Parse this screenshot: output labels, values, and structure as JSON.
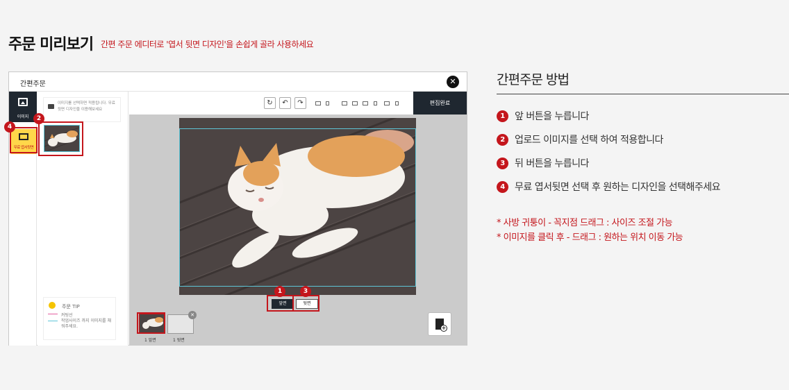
{
  "header": {
    "title": "주문 미리보기",
    "subtitle": "간편 주문 에디터로 '엽서 뒷면 디자인'을 손쉽게 골라 사용하세요"
  },
  "editor": {
    "window_title": "간편주문",
    "close_icon": "close-icon",
    "nav": {
      "image_label": "이미지",
      "postcard_label": "무료 엽서뒷면"
    },
    "panel": {
      "info_text": "이미지를 선택하면 적용됩니다. 무료 뒷면 디자인을 이용해보세요"
    },
    "tip": {
      "title": "주문 TIP",
      "line1": "커팅선",
      "line2": "작업사이즈 까지 이미지를 채워주세요."
    },
    "toolbar": {
      "done_label": "편집완료",
      "icons": [
        "rotate-icon",
        "rotate-left-90-icon",
        "rotate-right-90-icon",
        "size-option-icons"
      ]
    },
    "sides": {
      "front_label": "앞면",
      "back_label": "뒷면"
    },
    "pages": {
      "page1_label": "1 앞면",
      "page2_label": "1 뒷면"
    },
    "badges": {
      "b1": "1",
      "b2": "2",
      "b3": "3",
      "b4": "4"
    }
  },
  "howto": {
    "title": "간편주문 방법",
    "steps": [
      {
        "num": "1",
        "text": "앞 버튼을 누릅니다"
      },
      {
        "num": "2",
        "text": "업로드 이미지를 선택 하여 적용합니다"
      },
      {
        "num": "3",
        "text": "뒤 버튼을 누릅니다"
      },
      {
        "num": "4",
        "text": "무료 엽서뒷면 선택 후 원하는 디자인을 선택해주세요"
      }
    ],
    "notes": [
      "* 사방 귀퉁이 - 꼭지점 드래그 : 사이즈 조절 가능",
      "* 이미지를 클릭 후 - 드래그 : 원하는 위치 이동 가능"
    ]
  },
  "colors": {
    "accent": "#c4161c",
    "dark": "#1f2730",
    "guide": "#5ec6d8",
    "highlight": "#ffd74a"
  }
}
